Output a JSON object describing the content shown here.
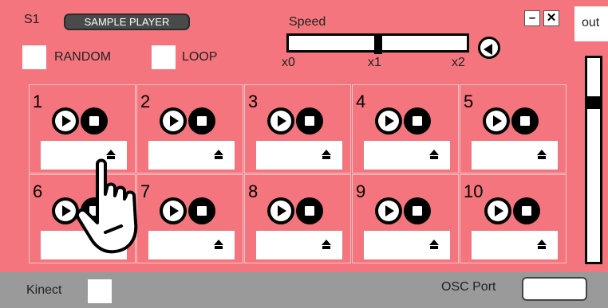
{
  "header": {
    "slot": "S1",
    "title_badge": "SAMPLE PLAYER",
    "random_label": "RANDOM",
    "loop_label": "LOOP",
    "minimize_icon": "–",
    "close_icon": "✕"
  },
  "speed": {
    "label": "Speed",
    "ticks": [
      "x0",
      "x1",
      "x2"
    ],
    "value": 1
  },
  "out": {
    "label": "out",
    "level": 0.8
  },
  "pads": [
    {
      "num": "1"
    },
    {
      "num": "2"
    },
    {
      "num": "3"
    },
    {
      "num": "4"
    },
    {
      "num": "5"
    },
    {
      "num": "6"
    },
    {
      "num": "7"
    },
    {
      "num": "8"
    },
    {
      "num": "9"
    },
    {
      "num": "10"
    }
  ],
  "footer": {
    "kinect_label": "Kinect",
    "osc_label": "OSC Port",
    "osc_value": ""
  },
  "colors": {
    "panel": "#f4757d",
    "footer": "#9a9a9a"
  }
}
